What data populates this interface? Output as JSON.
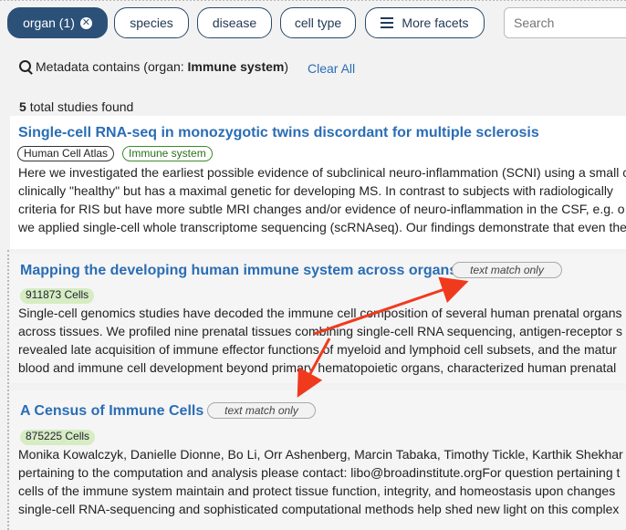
{
  "facets": {
    "organ": "organ (1)",
    "species": "species",
    "disease": "disease",
    "cell_type": "cell type",
    "more": "More facets",
    "search_placeholder": "Search"
  },
  "query": {
    "prefix": "Metadata contains (organ: ",
    "value": "Immune system",
    "suffix": ")",
    "clear_all": "Clear All"
  },
  "results": {
    "count": "5",
    "count_label": "total studies found"
  },
  "studies": [
    {
      "title": "Single-cell RNA-seq in monozygotic twins discordant for multiple sclerosis",
      "tags": [
        "Human Cell Atlas",
        "Immune system"
      ],
      "description": [
        "Here we investigated the earliest possible evidence of subclinical neuro-inflammation (SCNI) using a small c",
        "clinically \"healthy\" but has a maximal genetic for developing MS. In contrast to subjects with radiologically",
        "criteria for RIS but have more subtle MRI changes and/or evidence of neuro-inflammation in the CSF, e.g. o",
        "we applied single-cell whole transcriptome sequencing (scRNAseq). Our findings demonstrate that even the"
      ]
    },
    {
      "title": "Mapping the developing human immune system across organs",
      "match_label": "text match only",
      "cells": "911873 Cells",
      "description": [
        "Single-cell genomics studies have decoded the immune cell composition of several human prenatal organs",
        "across tissues. We profiled nine prenatal tissues combining single-cell RNA sequencing, antigen-receptor s",
        "revealed late acquisition of immune effector functions of myeloid and lymphoid cell subsets, and the matur",
        "blood and immune cell development beyond primary hematopoietic organs, characterized human prenatal"
      ]
    },
    {
      "title": "A Census of Immune Cells",
      "match_label": "text match only",
      "cells": "875225 Cells",
      "description": [
        "Monika Kowalczyk, Danielle Dionne, Bo Li, Orr Ashenberg, Marcin Tabaka, Timothy Tickle, Karthik Shekhar",
        "pertaining to the computation and analysis please contact: libo@broadinstitute.orgFor question pertaining t",
        "cells of the immune system maintain and protect tissue function, integrity, and homeostasis upon changes",
        "single-cell RNA-sequencing and sophisticated computational methods help shed new light on this complex"
      ]
    }
  ],
  "colors": {
    "link": "#2a6db5",
    "facet_active": "#2b5178",
    "cells_badge": "#d6ecc2",
    "immune_tag": "#3d8c2c",
    "arrow": "#f03a1e"
  }
}
